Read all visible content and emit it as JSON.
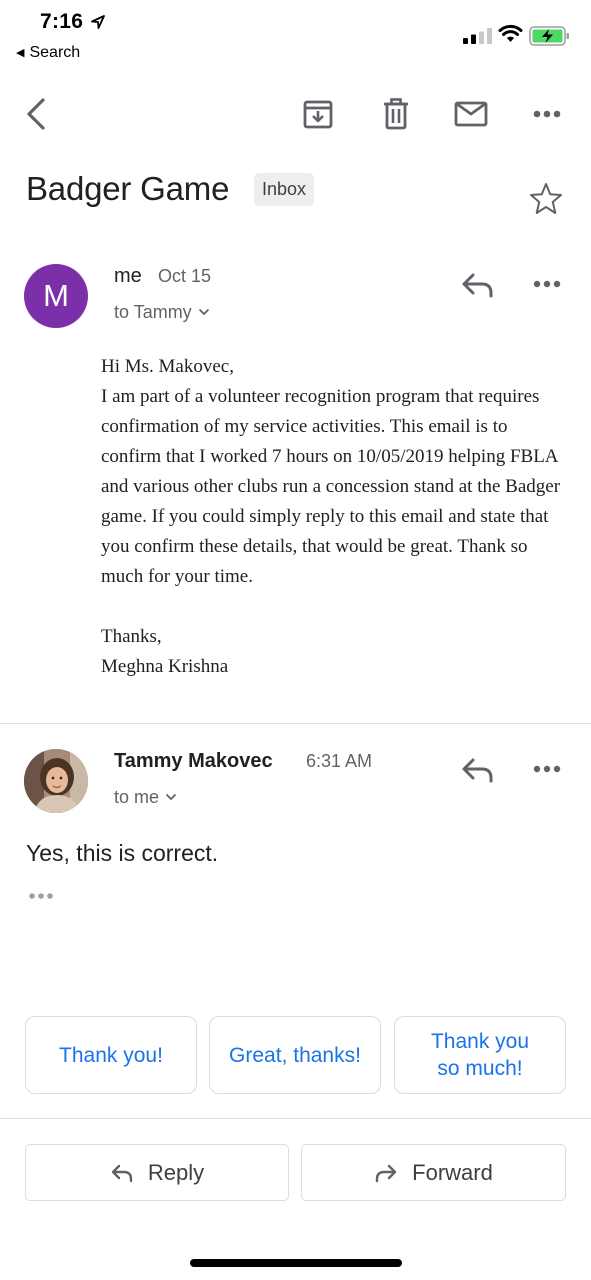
{
  "status_bar": {
    "time": "7:16",
    "back_app_label": "Search",
    "icons": [
      "location-arrow-icon",
      "signal-icon",
      "wifi-icon",
      "battery-charging-icon"
    ]
  },
  "toolbar": {
    "icons": [
      "back-icon",
      "archive-icon",
      "delete-icon",
      "mail-icon",
      "more-icon"
    ]
  },
  "thread": {
    "subject": "Inbox",
    "title": "Badger Game",
    "label": "Inbox"
  },
  "messages": [
    {
      "avatar_letter": "M",
      "avatar_color": "#7b2fa8",
      "sender": "me",
      "date": "Oct 15",
      "to": "to Tammy",
      "body": [
        "Hi Ms. Makovec,",
        "I am part of a volunteer recognition program that requires confirmation of my service activities. This email is to confirm that I worked 7 hours on 10/05/2019 helping FBLA and various other clubs run a concession stand at the Badger game. If you could simply reply to this email and state that you confirm these details, that would be great. Thank so much for your time.",
        "Thanks,",
        "Meghna Krishna"
      ]
    },
    {
      "sender": "Tammy Makovec",
      "date": "6:31 AM",
      "to": "to me",
      "body": "Yes, this is correct."
    }
  ],
  "smart_replies": [
    "Thank you!",
    "Great, thanks!",
    "Thank you so much!"
  ],
  "actions": {
    "reply_label": "Reply",
    "forward_label": "Forward"
  },
  "colors": {
    "accent": "#1a73e8",
    "avatar": "#7b2fa8",
    "battery": "#4cd964"
  }
}
